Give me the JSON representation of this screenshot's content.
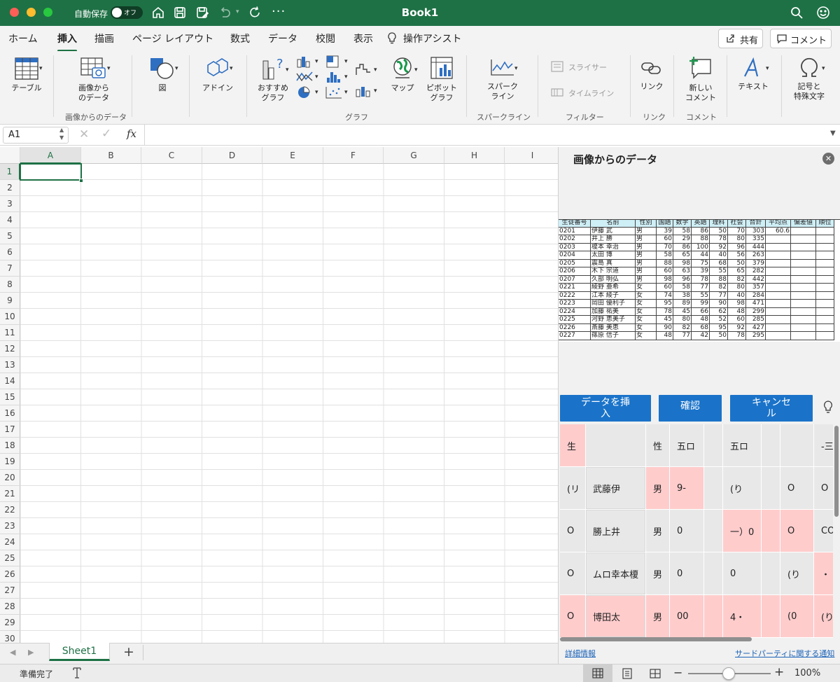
{
  "window": {
    "title": "Book1",
    "autosave_label": "自動保存",
    "autosave_state": "オフ"
  },
  "ribbon_tabs": [
    "ホーム",
    "挿入",
    "描画",
    "ページ レイアウト",
    "数式",
    "データ",
    "校閲",
    "表示"
  ],
  "tell_me": "操作アシスト",
  "share_label": "共有",
  "comment_label": "コメント",
  "ribbon": {
    "table": "テーブル",
    "data_from_picture_l1": "画像から",
    "data_from_picture_l2": "のデータ",
    "group_picture": "画像からのデータ",
    "pictures": "図",
    "addins": "アドイン",
    "rec_charts_l1": "おすすめ",
    "rec_charts_l2": "グラフ",
    "maps": "マップ",
    "pivot_l1": "ピボット",
    "pivot_l2": "グラフ",
    "group_chart": "グラフ",
    "sparkline_l1": "スパーク",
    "sparkline_l2": "ライン",
    "group_sparkline": "スパークライン",
    "slicer": "スライサー",
    "timeline": "タイムライン",
    "group_filter": "フィルター",
    "link": "リンク",
    "group_link": "リンク",
    "new_comment_l1": "新しい",
    "new_comment_l2": "コメント",
    "group_comment": "コメント",
    "text": "テキスト",
    "symbols_l1": "記号と",
    "symbols_l2": "特殊文字"
  },
  "formula_bar": {
    "name_box": "A1",
    "fx": "fx",
    "value": ""
  },
  "columns": [
    "A",
    "B",
    "C",
    "D",
    "E",
    "F",
    "G",
    "H",
    "I"
  ],
  "rows": [
    "1",
    "2",
    "3",
    "4",
    "5",
    "6",
    "7",
    "8",
    "9",
    "10",
    "11",
    "12",
    "13",
    "14",
    "15",
    "16",
    "17",
    "18",
    "19",
    "20",
    "21",
    "22",
    "23",
    "24",
    "25",
    "26",
    "27",
    "28",
    "29",
    "30"
  ],
  "sheet_tab": "Sheet1",
  "status": {
    "ready": "準備完了",
    "zoom": "100%"
  },
  "pane": {
    "title": "画像からのデータ",
    "insert_btn": "データを挿入",
    "review_btn": "確認",
    "cancel_btn": "キャンセル",
    "details_link": "詳細情報",
    "third_party_link": "サードパーティに関する通知",
    "source_headers": [
      "生徒番号",
      "名前",
      "性別",
      "国語",
      "数学",
      "英語",
      "理科",
      "社会",
      "合計",
      "平均点",
      "偏差値",
      "順位"
    ],
    "source_rows": [
      [
        "0201",
        "伊藤 武",
        "男",
        "39",
        "58",
        "86",
        "50",
        "70",
        "303",
        "60.6",
        "",
        ""
      ],
      [
        "0202",
        "井上 勝",
        "男",
        "60",
        "29",
        "88",
        "78",
        "80",
        "335",
        "",
        "",
        ""
      ],
      [
        "0203",
        "榎本 幸治",
        "男",
        "70",
        "86",
        "100",
        "92",
        "96",
        "444",
        "",
        "",
        ""
      ],
      [
        "0204",
        "太田 博",
        "男",
        "58",
        "65",
        "44",
        "40",
        "56",
        "263",
        "",
        "",
        ""
      ],
      [
        "0205",
        "震島 真",
        "男",
        "88",
        "98",
        "75",
        "68",
        "50",
        "379",
        "",
        "",
        ""
      ],
      [
        "0206",
        "木下 宗道",
        "男",
        "60",
        "63",
        "39",
        "55",
        "65",
        "282",
        "",
        "",
        ""
      ],
      [
        "0207",
        "久部 明弘",
        "男",
        "98",
        "96",
        "78",
        "88",
        "82",
        "442",
        "",
        "",
        ""
      ],
      [
        "0221",
        "綾野 亜希",
        "女",
        "60",
        "58",
        "77",
        "82",
        "80",
        "357",
        "",
        "",
        ""
      ],
      [
        "0222",
        "江本 綾子",
        "女",
        "74",
        "38",
        "55",
        "77",
        "40",
        "284",
        "",
        "",
        ""
      ],
      [
        "0223",
        "岡田 優利子",
        "女",
        "95",
        "89",
        "99",
        "90",
        "98",
        "471",
        "",
        "",
        ""
      ],
      [
        "0224",
        "加藤 祐美",
        "女",
        "78",
        "45",
        "66",
        "62",
        "48",
        "299",
        "",
        "",
        ""
      ],
      [
        "0225",
        "河野 恵美子",
        "女",
        "45",
        "80",
        "48",
        "52",
        "60",
        "285",
        "",
        "",
        ""
      ],
      [
        "0226",
        "斎藤 美恵",
        "女",
        "90",
        "82",
        "68",
        "95",
        "92",
        "427",
        "",
        "",
        ""
      ],
      [
        "0227",
        "篠原 信子",
        "女",
        "48",
        "77",
        "42",
        "50",
        "78",
        "295",
        "",
        "",
        ""
      ]
    ],
    "preview_rows": [
      [
        "生",
        "",
        "性",
        "五ロ",
        "",
        "五ロ",
        "",
        "",
        "-三ロ"
      ],
      [
        "(リ",
        "武藤伊",
        "男",
        "9-",
        "",
        "(り",
        "",
        "O",
        "O"
      ],
      [
        "O",
        "勝上井",
        "男",
        "0",
        "",
        "一）0",
        "",
        "O",
        "CO"
      ],
      [
        "O",
        "ムロ幸本榎",
        "男",
        "0",
        "",
        "0",
        "",
        "(り",
        "・"
      ],
      [
        "O",
        "博田太",
        "男",
        "00",
        "",
        "4・",
        "",
        "(0",
        "(り"
      ]
    ],
    "preview_pink": [
      [
        true,
        false,
        false,
        false,
        false,
        false,
        false,
        false,
        false
      ],
      [
        false,
        false,
        true,
        true,
        false,
        false,
        false,
        false,
        false
      ],
      [
        false,
        false,
        false,
        false,
        false,
        true,
        true,
        true,
        false
      ],
      [
        false,
        false,
        false,
        false,
        false,
        false,
        false,
        false,
        true
      ],
      [
        true,
        true,
        true,
        true,
        true,
        true,
        true,
        true,
        true
      ]
    ]
  }
}
